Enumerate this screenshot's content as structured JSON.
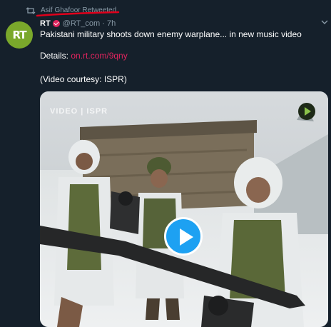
{
  "retweet": {
    "label": "Asif Ghafoor Retweeted"
  },
  "tweet": {
    "author": "RT",
    "handle": "@RT_com · 7h",
    "text_line1": "Pakistani military shoots down enemy warplane... in new music video",
    "details_label": "Details: ",
    "link": "on.rt.com/9qny",
    "courtesy": "(Video courtesy: ISPR)"
  },
  "avatar": {
    "text": "RT"
  },
  "media": {
    "watermark": "VIDEO | ISPR"
  },
  "colors": {
    "background": "#15202b",
    "link": "#e0245e",
    "muted": "#8899a6",
    "play_button": "#1da1f2",
    "annotation": "#e0001b",
    "avatar": "#7aa82b"
  }
}
